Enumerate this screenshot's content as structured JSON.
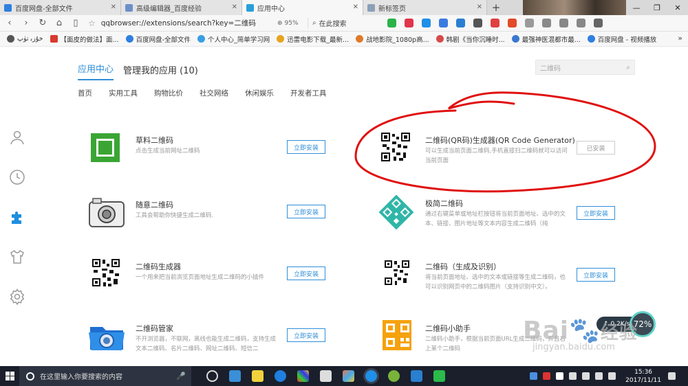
{
  "tabs": [
    {
      "label": "百度网盘-全部文件",
      "color": "#2f7fe0",
      "active": false
    },
    {
      "label": "高级编辑器_百度经验",
      "color": "#6c8fc9",
      "active": false
    },
    {
      "label": "应用中心",
      "color": "#2a9fd8",
      "active": true
    },
    {
      "label": "新标签页",
      "color": "#8aa0b8",
      "active": false
    }
  ],
  "address": {
    "url": "qqbrowser://extensions/search?key=二维码",
    "zoom": "95%",
    "search_placeholder": "在此搜索"
  },
  "bookmarks": [
    {
      "label": "ﺧﯘﺯﺑ ﺗﯜپ",
      "color": "#555555"
    },
    {
      "label": "【面皮的做法】面...",
      "color": "#d63a2f"
    },
    {
      "label": "百度网盘-全部文件",
      "color": "#2f7fe0"
    },
    {
      "label": "个人中心_简单学习网",
      "color": "#3a9ee4"
    },
    {
      "label": "迅雷电影下载_最新...",
      "color": "#e6a41f"
    },
    {
      "label": "战地影院_1080p高...",
      "color": "#e07a2a"
    },
    {
      "label": "韩剧《当你沉睡时...",
      "color": "#d64a4a"
    },
    {
      "label": "最强神医混都市最...",
      "color": "#3b77d0"
    },
    {
      "label": "百度网盘 - 视频播放",
      "color": "#2f7fe0"
    }
  ],
  "page": {
    "tab_center": "应用中心",
    "tab_manage": "管理我的应用 (10)",
    "search_value": "二维码",
    "categories": [
      "首页",
      "实用工具",
      "购物比价",
      "社交网络",
      "休闲娱乐",
      "开发者工具"
    ]
  },
  "apps": [
    {
      "title": "草料二维码",
      "desc": "点击生成当前网址二维码",
      "button": "立即安装",
      "installed": false,
      "icon": "green-frame-icon"
    },
    {
      "title": "二维码(QR码)生成器(QR Code Generator)",
      "desc": "可以生成当前页面二维码,手机直接扫二维码就可以访问当前页面",
      "button": "已安装",
      "installed": true,
      "icon": "qr-code-icon"
    },
    {
      "title": "随意二维码",
      "desc": "工具会帮助你快捷生成二维码.",
      "button": "立即安装",
      "installed": false,
      "icon": "camera-icon"
    },
    {
      "title": "极简二维码",
      "desc": "通过右键菜单或地址栏按钮将当前页面地址、选中的文本、链接、图片地址等文本内容生成二维码（纯",
      "button": "立即安装",
      "installed": false,
      "icon": "teal-qr-icon"
    },
    {
      "title": "二维码生成器",
      "desc": "一个用来把当前浏览页面地址生成二维码的小插件",
      "button": "立即安装",
      "installed": false,
      "icon": "qr-code-icon"
    },
    {
      "title": "二维码（生成及识别）",
      "desc": "将当前页面地址、选中的文本或链接等生成二维码，也可以识别网页中的二维码图片（支持识别中文）。",
      "button": "立即安装",
      "installed": false,
      "icon": "qr-code-icon"
    },
    {
      "title": "二维码管家",
      "desc": "不开浏览器，不联网，离线也能生成二维码，支持生成文本二维码、名片二维码、网址二维码、短信二",
      "button": "立即安装",
      "installed": false,
      "icon": "blue-folder-icon"
    },
    {
      "title": "二维码小助手",
      "desc": "二维码小助手，根据当前页面URL生成二维码，并且右上某个二维码",
      "button": "立即安装",
      "installed": false,
      "icon": "orange-qr-icon"
    }
  ],
  "speed": {
    "rate": "0.2K/s",
    "percent": "72%"
  },
  "watermark": {
    "brand": "Bai",
    "brand2": "经验",
    "domain": "jingyan.baidu.com"
  },
  "taskbar": {
    "search_placeholder": "在这里输入你要搜索的内容",
    "time": "15:36",
    "date": "2017/11/11"
  },
  "colors": {
    "accent": "#2f8fd8",
    "annotation": "#e01010"
  }
}
